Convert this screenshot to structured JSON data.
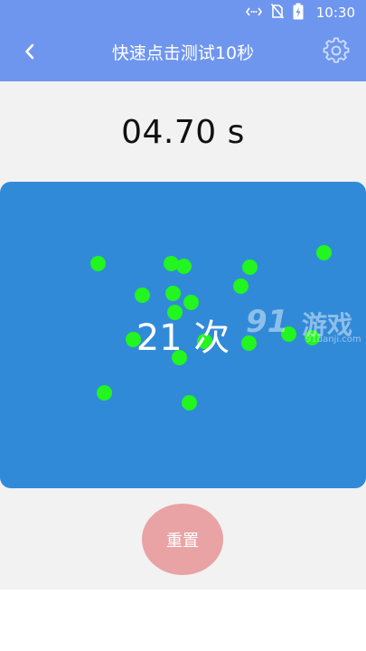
{
  "status_bar": {
    "time": "10:30",
    "icons": [
      "vibrate-icon",
      "no-sim-icon",
      "battery-charging-icon"
    ]
  },
  "header": {
    "title": "快速点击测试10秒",
    "back_icon": "chevron-left-icon",
    "settings_icon": "gear-icon"
  },
  "timer": {
    "value": "04.70 s"
  },
  "tap_area": {
    "count_text": "21 次",
    "count": 21,
    "dot_color": "#22f51f",
    "background_color": "#318ad8"
  },
  "reset_button": {
    "label": "重置"
  },
  "watermark": {
    "number": "91",
    "text": "游戏",
    "url": "91danji.com"
  },
  "colors": {
    "appbar": "#6f96ee",
    "content_background": "#f2f2f2",
    "reset_button": "#e9a3a4"
  }
}
